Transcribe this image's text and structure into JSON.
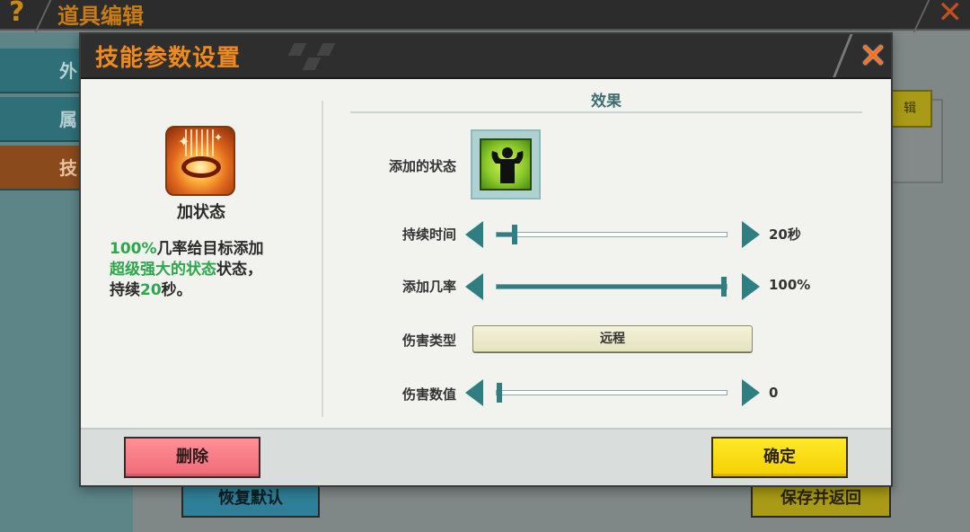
{
  "background": {
    "help_icon": "question-icon",
    "title": "道具编辑",
    "close_icon": "close-icon",
    "sidebar_tabs": [
      {
        "label": "外"
      },
      {
        "label": "属"
      },
      {
        "label": "技"
      }
    ],
    "restore_default_label": "恢复默认",
    "save_return_label": "保存并返回"
  },
  "dialog": {
    "title": "技能参数设置",
    "close_icon": "close-icon",
    "skill": {
      "icon": "add-status-skill-icon",
      "name": "加状态",
      "desc_rate": "100%",
      "desc_part1": "几率给目标添加",
      "desc_status": "超级强大的状态",
      "desc_part2": "状态，",
      "desc_part3": "持续",
      "desc_duration": "20",
      "desc_part4": "秒。"
    },
    "effect": {
      "section_title": "效果",
      "added_status_label": "添加的状态",
      "added_status_icon": "strength-buff-icon",
      "duration": {
        "label": "持续时间",
        "value_text": "20秒",
        "fraction": 0.08
      },
      "rate": {
        "label": "添加几率",
        "value_text": "100%",
        "fraction": 1.0
      },
      "damage_type": {
        "label": "伤害类型",
        "value": "远程"
      },
      "damage_value": {
        "label": "伤害数值",
        "value_text": "0",
        "fraction": 0.0
      }
    },
    "delete_label": "删除",
    "confirm_label": "确定"
  },
  "colors": {
    "accent_orange": "#f08a1c",
    "teal": "#2f7f82",
    "highlight_green": "#2aa84a",
    "delete_red": "#f06a76",
    "confirm_yellow": "#f4cf00"
  }
}
